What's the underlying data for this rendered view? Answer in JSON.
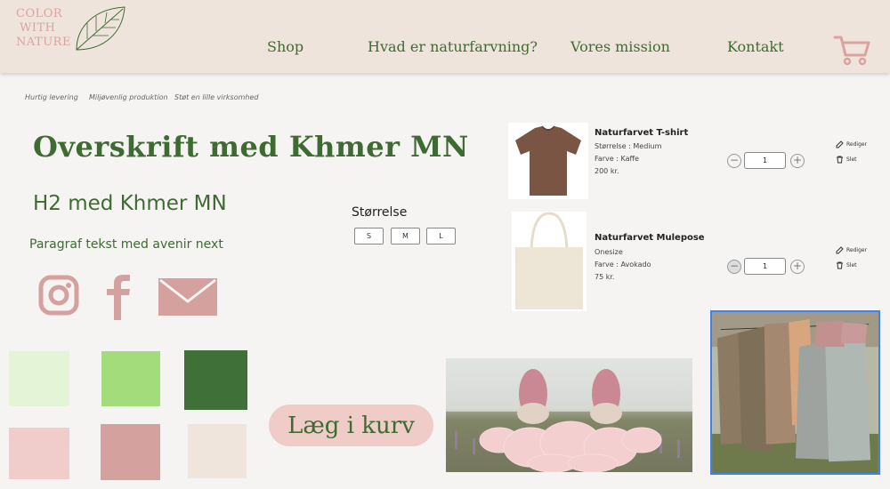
{
  "header": {
    "logo": {
      "line1": "COLOR",
      "line2": "WITH",
      "line3": "NATURE"
    },
    "nav": [
      "Shop",
      "Hvad er naturfarvning?",
      "Vores mission",
      "Kontakt"
    ],
    "cart_icon": "shopping-cart-icon"
  },
  "trust": [
    "Hurtig levering",
    "Miljøvenlig produktion",
    "Støt en lille virksomhed"
  ],
  "typography": {
    "h1": "Overskrift med Khmer MN",
    "h2": "H2 med Khmer MN",
    "paragraph": "Paragraf tekst med avenir next"
  },
  "social_icons": [
    "instagram-icon",
    "facebook-icon",
    "mail-icon"
  ],
  "size_selector": {
    "label": "Størrelse",
    "options": [
      "S",
      "M",
      "L"
    ]
  },
  "swatches": [
    "#e3f5d6",
    "#a3dd7b",
    "#3e7038",
    "#f0cdcb",
    "#d4a19f",
    "#efe5dd"
  ],
  "add_to_cart": "Læg i kurv",
  "cart_items": [
    {
      "name": "Naturfarvet T-shirt",
      "size": "Størrelse : Medium",
      "color": "Farve : Kaffe",
      "price": "200 kr.",
      "qty": "1",
      "edit": "Rediger",
      "delete": "Slet"
    },
    {
      "name": "Naturfarvet Mulepose",
      "size": "Onesize",
      "color": "Farve : Avokado",
      "price": "75 kr.",
      "qty": "1",
      "edit": "Rediger",
      "delete": "Slet"
    }
  ],
  "colors": {
    "green": "#3e6b32",
    "pink": "#d9a3a0",
    "header_bg": "#efe4dc"
  }
}
